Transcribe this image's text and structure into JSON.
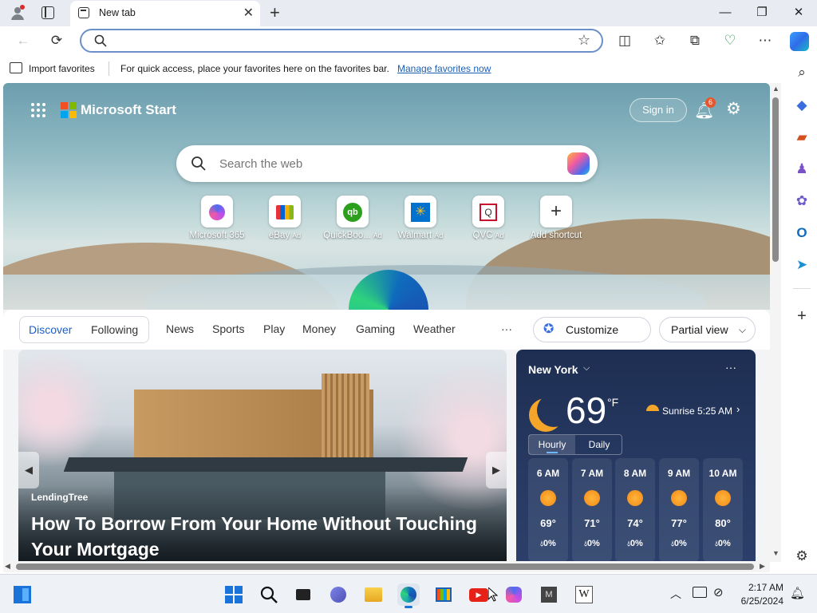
{
  "browser": {
    "tab_title": "New tab",
    "address_value": "",
    "favorites_bar": {
      "import_label": "Import favorites",
      "message": "For quick access, place your favorites here on the favorites bar.",
      "manage_link": "Manage favorites now"
    }
  },
  "start": {
    "brand": "Microsoft Start",
    "sign_in": "Sign in",
    "notification_count": "6",
    "search_placeholder": "Search the web",
    "shortcuts": [
      {
        "label": "Microsoft 365",
        "ad": "",
        "icon": "microsoft-365-icon"
      },
      {
        "label": "eBay",
        "ad": "Ad",
        "icon": "ebay-icon"
      },
      {
        "label": "QuickBoo...",
        "ad": "Ad",
        "icon": "quickbooks-icon"
      },
      {
        "label": "Walmart",
        "ad": "Ad",
        "icon": "walmart-icon"
      },
      {
        "label": "QVC",
        "ad": "Ad",
        "icon": "qvc-icon"
      },
      {
        "label": "Add shortcut",
        "ad": "",
        "icon": "plus-icon"
      }
    ]
  },
  "feed": {
    "toggle": [
      "Discover",
      "Following"
    ],
    "tabs": [
      "News",
      "Sports",
      "Play",
      "Money",
      "Gaming",
      "Weather"
    ],
    "more": "···",
    "customize": "Customize feed",
    "view": "Partial view",
    "article": {
      "source": "LendingTree",
      "headline": "How To Borrow From Your Home Without Touching Your Mortgage"
    }
  },
  "weather": {
    "location": "New York",
    "temperature": "69",
    "unit": "°F",
    "sunrise": "Sunrise 5:25 AM",
    "tabs": [
      "Hourly",
      "Daily"
    ],
    "hourly": [
      {
        "hour": "6 AM",
        "temp": "69°",
        "precip": "0%"
      },
      {
        "hour": "7 AM",
        "temp": "71°",
        "precip": "0%"
      },
      {
        "hour": "8 AM",
        "temp": "74°",
        "precip": "0%"
      },
      {
        "hour": "9 AM",
        "temp": "77°",
        "precip": "0%"
      },
      {
        "hour": "10 AM",
        "temp": "80°",
        "precip": "0%"
      }
    ]
  },
  "taskbar": {
    "time": "2:17 AM",
    "date": "6/25/2024"
  },
  "colors": {
    "accent": "#1a73d9",
    "edge_blue": "#0f6cbd",
    "weather_bg": "#1e2e52"
  }
}
